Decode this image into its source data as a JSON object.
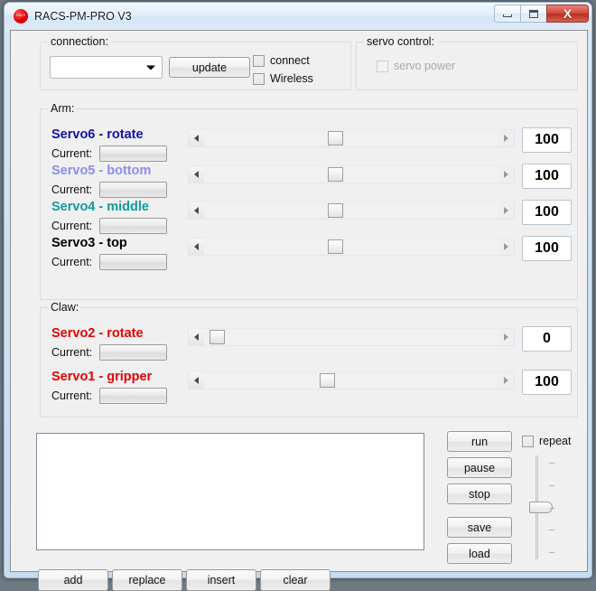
{
  "window": {
    "title": "RACS-PM-PRO V3",
    "icon": "app-logo-icon",
    "buttons": {
      "minimize": "–",
      "maximize": "□",
      "close": "X"
    }
  },
  "connection": {
    "legend": "connection:",
    "port_value": "",
    "port_placeholder": "",
    "update_label": "update",
    "connect_label": "connect",
    "wireless_label": "Wireless",
    "connect_checked": false,
    "wireless_checked": false
  },
  "servo_control": {
    "legend": "servo control:",
    "power_label": "servo power",
    "power_checked": false,
    "power_disabled": true
  },
  "arm": {
    "legend": "Arm:",
    "current_label": "Current:",
    "servos": [
      {
        "name": "Servo6 - rotate",
        "color": "#1111aa",
        "value": "100",
        "thumb_pct": 44,
        "current": ""
      },
      {
        "name": "Servo5 - bottom",
        "color": "#8c8cf5",
        "value": "100",
        "thumb_pct": 44,
        "current": ""
      },
      {
        "name": "Servo4 - middle",
        "color": "#0f9a9a",
        "value": "100",
        "thumb_pct": 44,
        "current": ""
      },
      {
        "name": "Servo3 - top",
        "color": "#000000",
        "value": "100",
        "thumb_pct": 44,
        "current": ""
      }
    ]
  },
  "claw": {
    "legend": "Claw:",
    "current_label": "Current:",
    "servos": [
      {
        "name": "Servo2 - rotate",
        "color": "#e60000",
        "value": "0",
        "thumb_pct": 2,
        "current": ""
      },
      {
        "name": "Servo1 - gripper",
        "color": "#e60000",
        "value": "100",
        "thumb_pct": 41,
        "current": ""
      }
    ]
  },
  "program": {
    "list_items": [],
    "edit_buttons": [
      "add",
      "replace",
      "insert",
      "clear"
    ],
    "run_buttons": [
      "run",
      "pause",
      "stop",
      "save",
      "load"
    ],
    "repeat_label": "repeat",
    "repeat_checked": false,
    "speed_ticks": 5,
    "speed_thumb_pct": 50
  }
}
